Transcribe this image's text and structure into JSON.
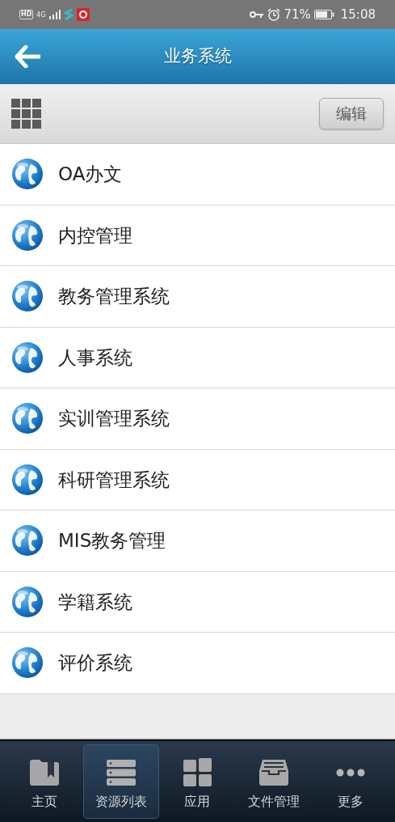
{
  "status_bar": {
    "hd": "HD",
    "network": "4G",
    "battery_percent": "71%",
    "time": "15:08"
  },
  "header": {
    "title": "业务系统"
  },
  "toolbar": {
    "edit_button": "编辑"
  },
  "systems": [
    {
      "name": "OA办文"
    },
    {
      "name": "内控管理"
    },
    {
      "name": "教务管理系统"
    },
    {
      "name": "人事系统"
    },
    {
      "name": "实训管理系统"
    },
    {
      "name": "科研管理系统"
    },
    {
      "name": "MIS教务管理"
    },
    {
      "name": "学籍系统"
    },
    {
      "name": "评价系统"
    }
  ],
  "bottom_nav": [
    {
      "label": "主页",
      "kind": "folder",
      "selected": false
    },
    {
      "label": "资源列表",
      "kind": "list",
      "selected": true
    },
    {
      "label": "应用",
      "kind": "apps",
      "selected": false
    },
    {
      "label": "文件管理",
      "kind": "drawer",
      "selected": false
    },
    {
      "label": "更多",
      "kind": "more",
      "selected": false
    }
  ]
}
